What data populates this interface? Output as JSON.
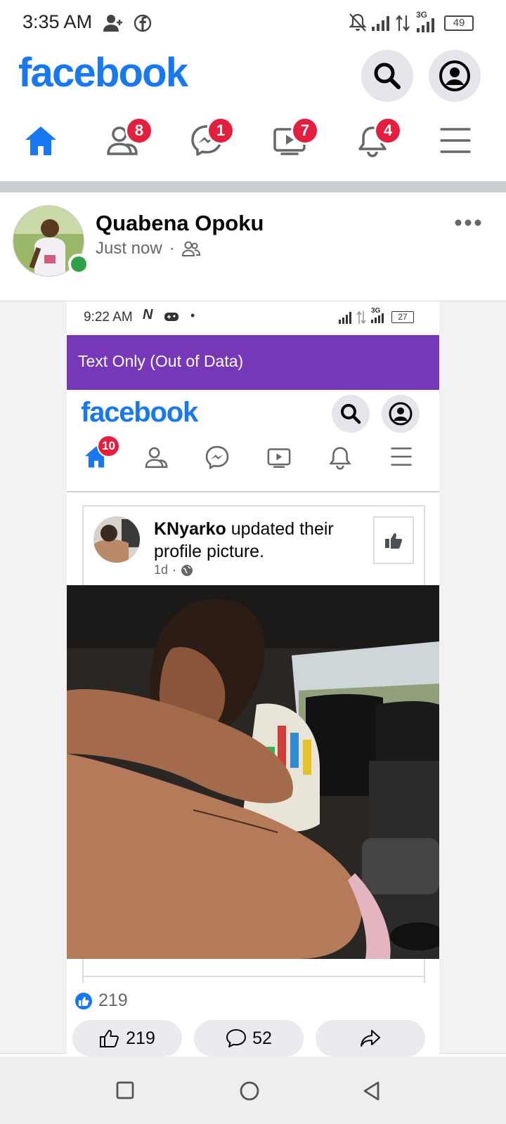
{
  "status_bar": {
    "time": "3:35 AM",
    "network": "3G",
    "battery": "49"
  },
  "header": {
    "logo": "facebook",
    "search_icon": "search-icon",
    "profile_icon": "account-circle-icon"
  },
  "nav": {
    "items": [
      {
        "name": "home",
        "icon": "home-icon",
        "badge": ""
      },
      {
        "name": "friends",
        "icon": "friends-icon",
        "badge": "8"
      },
      {
        "name": "messenger",
        "icon": "messenger-icon",
        "badge": "1"
      },
      {
        "name": "watch",
        "icon": "video-icon",
        "badge": "7"
      },
      {
        "name": "notifications",
        "icon": "bell-icon",
        "badge": "4"
      },
      {
        "name": "menu",
        "icon": "menu-icon",
        "badge": ""
      }
    ]
  },
  "post": {
    "author": "Quabena Opoku",
    "time": "Just now",
    "separator": "·",
    "audience_icon": "friends-icon",
    "more_icon": "more-icon"
  },
  "screenshot": {
    "status_time": "9:22 AM",
    "network": "3G",
    "battery": "27",
    "banner": "Text Only (Out of Data)",
    "logo": "facebook",
    "home_badge": "10",
    "story": {
      "name": "KNyarko",
      "action": " updated their profile picture.",
      "time": "1d",
      "separator": "·"
    }
  },
  "reactions": {
    "count": "219",
    "like_label": "219",
    "comment_label": "52"
  },
  "colors": {
    "brand": "#1877f2",
    "badge": "#e41e3f",
    "online": "#31a24c",
    "banner": "#7638b8"
  }
}
